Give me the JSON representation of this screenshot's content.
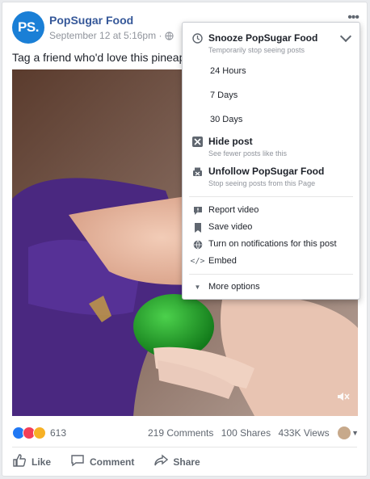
{
  "post": {
    "avatar_text": "PS.",
    "page_name": "PopSugar Food",
    "timestamp": "September 12 at 5:16pm",
    "meta_separator": "·",
    "text": "Tag a friend who'd love this pineapple"
  },
  "engagement": {
    "reaction_count": "613",
    "comments": "219 Comments",
    "shares": "100 Shares",
    "views": "433K Views"
  },
  "actions": {
    "like": "Like",
    "comment": "Comment",
    "share": "Share"
  },
  "menu": {
    "snooze_title": "Snooze PopSugar Food",
    "snooze_subtitle": "Temporarily stop seeing posts",
    "durations": [
      "24 Hours",
      "7 Days",
      "30 Days"
    ],
    "hide_title": "Hide post",
    "hide_subtitle": "See fewer posts like this",
    "unfollow_title": "Unfollow PopSugar Food",
    "unfollow_subtitle": "Stop seeing posts from this Page",
    "report": "Report video",
    "save": "Save video",
    "notifications": "Turn on notifications for this post",
    "embed": "Embed",
    "more": "More options"
  },
  "colors": {
    "brand_blue": "#365899",
    "avatar_blue": "#1a7fd6",
    "like_blue": "#2078f4",
    "love_red": "#f33e58",
    "wow_yellow": "#f7b125"
  }
}
